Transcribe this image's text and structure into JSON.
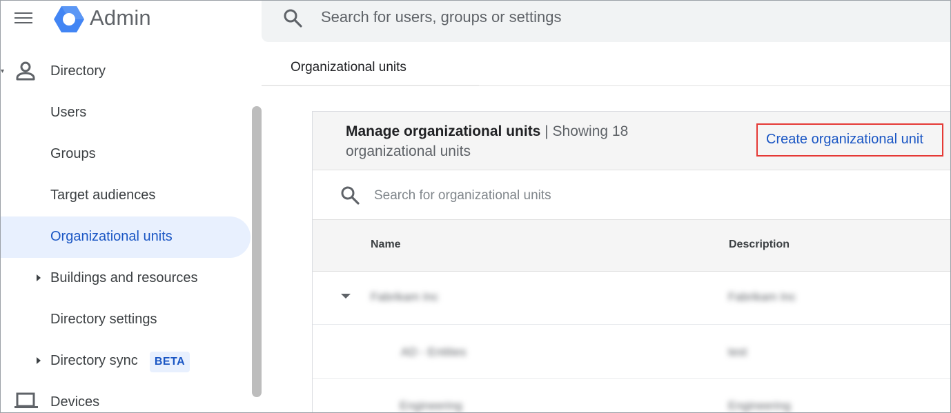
{
  "header": {
    "brand": "Admin",
    "search_placeholder": "Search for users, groups or settings"
  },
  "sidebar": {
    "section": "Directory",
    "items": [
      {
        "label": "Users"
      },
      {
        "label": "Groups"
      },
      {
        "label": "Target audiences"
      },
      {
        "label": "Organizational units",
        "active": true
      },
      {
        "label": "Buildings and resources",
        "expandable": true
      },
      {
        "label": "Directory settings"
      },
      {
        "label": "Directory sync",
        "expandable": true,
        "badge": "BETA"
      }
    ],
    "next_section": "Devices"
  },
  "main": {
    "breadcrumb": "Organizational units",
    "card": {
      "title": "Manage organizational units",
      "separator": "|",
      "subtitle": "Showing 18 organizational units",
      "create_label": "Create organizational unit",
      "search_placeholder": "Search for organizational units",
      "columns": [
        "Name",
        "Description"
      ],
      "rows": [
        {
          "name": "Fabrikam Inc",
          "description": "Fabrikam Inc"
        },
        {
          "name": "AD - Entities",
          "description": "test"
        },
        {
          "name": "Engineering",
          "description": "Engineering"
        }
      ]
    }
  },
  "colors": {
    "accent": "#1a56c4",
    "active_bg": "#e8f0fe",
    "highlight_border": "#e53935"
  }
}
